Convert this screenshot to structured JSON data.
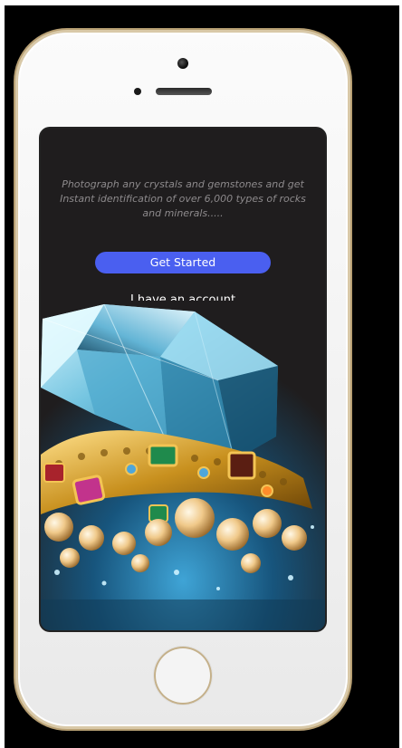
{
  "onboarding": {
    "intro_text": "Photograph any crystals and gemstones and get Instant identification of over 6,000 types of rocks and minerals.....",
    "get_started_label": "Get Started",
    "have_account_label": "I have an account"
  },
  "colors": {
    "accent": "#4a5ff0",
    "screen_background": "#1f1d1e",
    "intro_text": "#8d8a8c",
    "phone_trim": "#c9b48b"
  },
  "icons": {
    "home_button": "home-button-ring",
    "front_camera": "camera-dot",
    "speaker": "speaker-slot"
  }
}
